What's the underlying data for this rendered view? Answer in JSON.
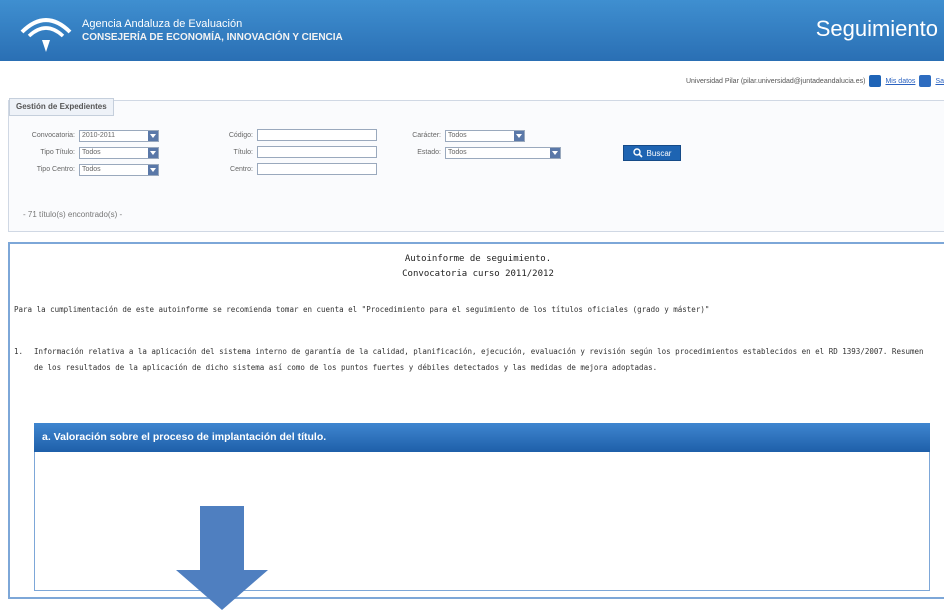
{
  "header": {
    "agency_line1": "Agencia Andaluza de Evaluación",
    "agency_line2": "CONSEJERÍA DE ECONOMÍA, INNOVACIÓN Y CIENCIA",
    "app_title": "Seguimiento",
    "colors": {
      "bar": "#2a6fb4",
      "text": "#ffffff"
    }
  },
  "userbar": {
    "user": "Universidad Pilar (pilar.universidad@juntadeandalucia.es)",
    "my_data_link": "Mis datos",
    "logout_link": "Sa"
  },
  "filters": {
    "tab_label": "Gestión de Expedientes",
    "convocatoria": {
      "label": "Convocatoria:",
      "value": "2010-2011"
    },
    "tipo_titulo": {
      "label": "Tipo Título:",
      "value": "Todos"
    },
    "tipo_centro": {
      "label": "Tipo Centro:",
      "value": "Todos"
    },
    "codigo": {
      "label": "Código:"
    },
    "titulo": {
      "label": "Título:"
    },
    "centro": {
      "label": "Centro:"
    },
    "caracter": {
      "label": "Carácter:",
      "value": "Todos"
    },
    "estado": {
      "label": "Estado:",
      "value": "Todos"
    },
    "search_button": "Buscar",
    "result_count": "- 71 título(s) encontrado(s) -"
  },
  "report": {
    "title_line1": "Autoinforme de seguimiento.",
    "title_line2": "Convocatoria curso 2011/2012",
    "intro": "Para la cumplimentación de este autoinforme se recomienda tomar en cuenta el \"Procedimiento para el seguimiento de los títulos oficiales (grado y máster)\"",
    "item_number": "1.",
    "item_text": "Información relativa a la aplicación del sistema interno de garantía de la calidad, planificación, ejecución, evaluación y revisión según los procedimientos establecidos en el RD 1393/2007. Resumen de los resultados de la aplicación de dicho sistema así como de los puntos fuertes y débiles detectados y las medidas de mejora adoptadas.",
    "section_heading": "a. Valoración sobre el proceso de implantación del título.",
    "colors": {
      "section_bar": "#2a6fb4",
      "border": "#7da7d8",
      "arrow": "#4f7fc0"
    }
  }
}
